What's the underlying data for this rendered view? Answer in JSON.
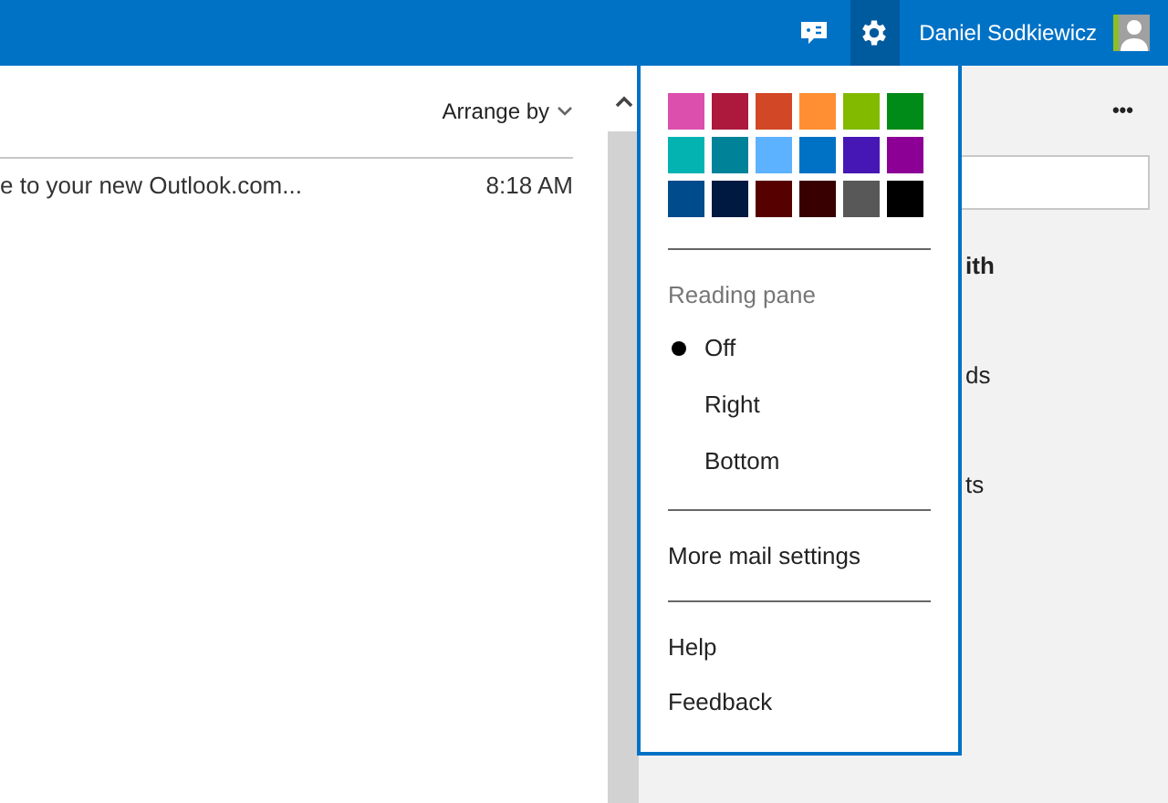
{
  "header": {
    "user_name": "Daniel Sodkiewicz"
  },
  "message_list": {
    "arrange_label": "Arrange by",
    "messages": [
      {
        "subject": "e to your new Outlook.com...",
        "time": "8:18 AM"
      }
    ]
  },
  "right_pane": {
    "more": "•••",
    "lines": [
      {
        "text": "ith",
        "bold": true
      },
      {
        "text": "ds",
        "bold": false
      },
      {
        "text": "ts",
        "bold": false
      }
    ]
  },
  "settings_menu": {
    "themes": [
      {
        "color": "#dc4fad"
      },
      {
        "color": "#ac193d"
      },
      {
        "color": "#d24726"
      },
      {
        "color": "#ff8f32"
      },
      {
        "color": "#82ba00"
      },
      {
        "color": "#008a17"
      },
      {
        "color": "#03b3b2"
      },
      {
        "color": "#008299"
      },
      {
        "color": "#5db2ff"
      },
      {
        "color": "#0072c6"
      },
      {
        "color": "#4617b4"
      },
      {
        "color": "#8c0095"
      },
      {
        "color": "#004b8b"
      },
      {
        "color": "#001940"
      },
      {
        "color": "#570000"
      },
      {
        "color": "#380000"
      },
      {
        "color": "#585858"
      },
      {
        "color": "#000000"
      }
    ],
    "reading_pane_label": "Reading pane",
    "reading_pane_options": [
      {
        "label": "Off",
        "selected": true
      },
      {
        "label": "Right",
        "selected": false
      },
      {
        "label": "Bottom",
        "selected": false
      }
    ],
    "more_settings": "More mail settings",
    "links": [
      "Help",
      "Feedback"
    ]
  }
}
